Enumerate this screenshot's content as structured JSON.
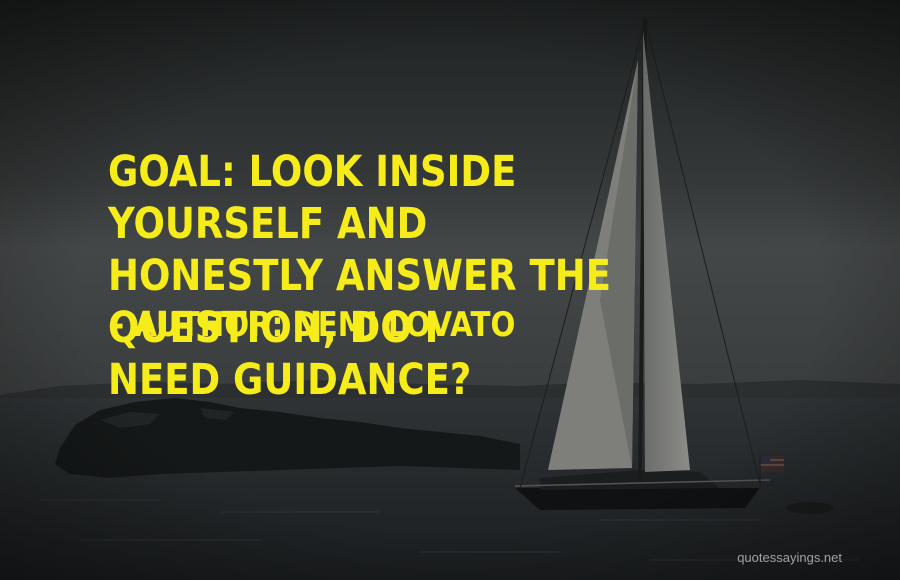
{
  "quote": {
    "text": "Goal: Look inside yourself and\nhonestly answer the question, Do I\nneed guidance?",
    "author_line": "- Author: Demi Lovato"
  },
  "watermark": {
    "text": "quotessayings.net"
  },
  "colors": {
    "text_accent": "#f5ec1a",
    "sky_top": "#1f2222",
    "sky_horizon": "#434545",
    "sea": "#222628",
    "land": "#141616"
  }
}
